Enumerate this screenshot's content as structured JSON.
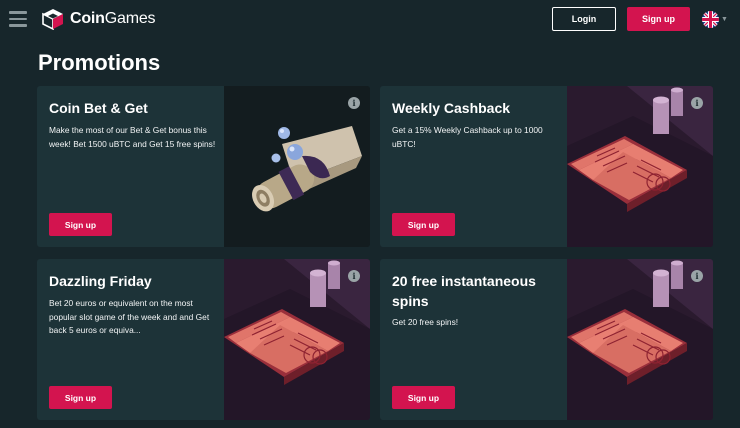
{
  "header": {
    "logo_text_bold": "Coin",
    "logo_text_rest": "Games",
    "login_label": "Login",
    "signup_label": "Sign up",
    "language": "en-GB"
  },
  "page": {
    "title": "Promotions"
  },
  "promotions": [
    {
      "title": "Coin Bet & Get",
      "description": "Make the most of our Bet & Get bonus this week! Bet 1500 uBTC and Get 15 free spins!",
      "button": "Sign up",
      "art": "scroll"
    },
    {
      "title": "Weekly Cashback",
      "description": "Get a 15% Weekly Cashback up to 1000 uBTC!",
      "button": "Sign up",
      "art": "spellbook"
    },
    {
      "title": "Dazzling Friday",
      "description": "Bet 20 euros or equivalent on the most popular slot game of the week and and Get back 5 euros or equiva...",
      "button": "Sign up",
      "art": "spellbook"
    },
    {
      "title": "20 free instantaneous spins",
      "description": "Get 20 free spins!",
      "button": "Sign up",
      "art": "spellbook"
    }
  ],
  "colors": {
    "background": "#17262b",
    "card": "#1d3338",
    "accent": "#d3144f"
  }
}
